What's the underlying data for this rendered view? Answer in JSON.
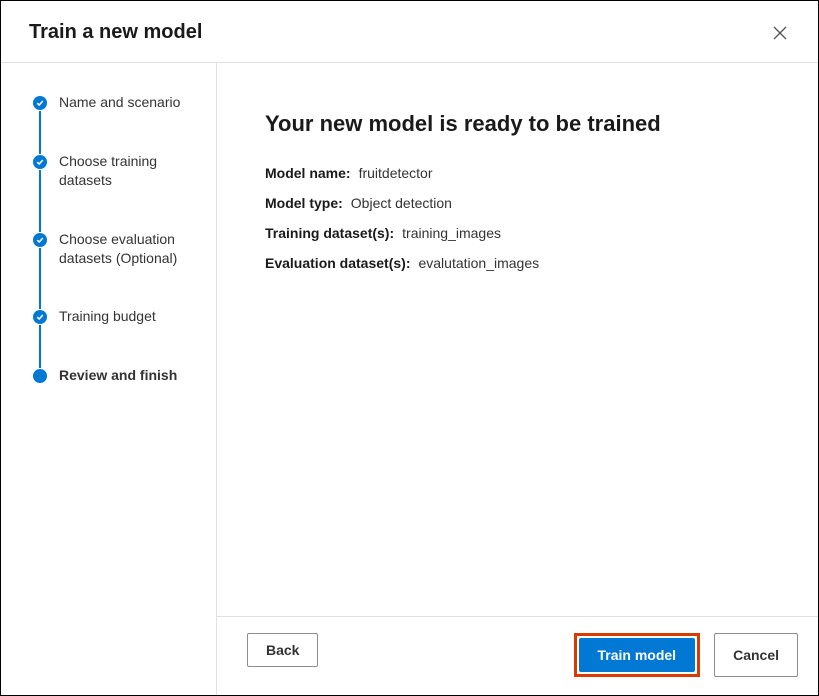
{
  "header": {
    "title": "Train a new model"
  },
  "sidebar": {
    "steps": [
      {
        "label": "Name and scenario"
      },
      {
        "label": "Choose training datasets"
      },
      {
        "label": "Choose evaluation datasets (Optional)"
      },
      {
        "label": "Training budget"
      },
      {
        "label": "Review and finish"
      }
    ]
  },
  "content": {
    "title": "Your new model is ready to be trained",
    "rows": {
      "model_name_label": "Model name:",
      "model_name_value": "fruitdetector",
      "model_type_label": "Model type:",
      "model_type_value": "Object detection",
      "training_ds_label": "Training dataset(s):",
      "training_ds_value": "training_images",
      "eval_ds_label": "Evaluation dataset(s):",
      "eval_ds_value": "evalutation_images"
    }
  },
  "footer": {
    "back": "Back",
    "train": "Train model",
    "cancel": "Cancel"
  }
}
